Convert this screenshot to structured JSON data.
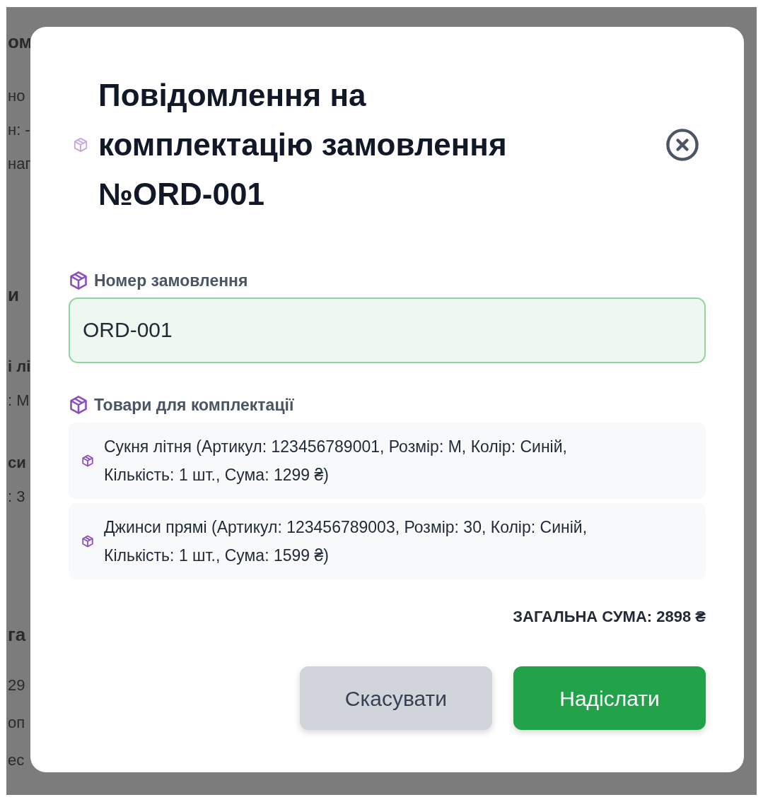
{
  "background": {
    "fragments": [
      {
        "text": "ом",
        "kind": "heading"
      },
      {
        "text": "но",
        "kind": "text"
      },
      {
        "text": "н: -",
        "kind": "text"
      },
      {
        "text": "наг",
        "kind": "text"
      },
      {
        "text": "и",
        "kind": "heading"
      },
      {
        "text": "і лі",
        "kind": "strong"
      },
      {
        "text": ": М",
        "kind": "text"
      },
      {
        "text": "си",
        "kind": "strong"
      },
      {
        "text": ": 3",
        "kind": "text"
      },
      {
        "text": "га",
        "kind": "heading"
      },
      {
        "text": "29",
        "kind": "text"
      },
      {
        "text": "оп",
        "kind": "text"
      },
      {
        "text": "ес",
        "kind": "text"
      }
    ]
  },
  "modal": {
    "title": "Повідомлення на комплектацію замовлення №ORD-001",
    "order_field": {
      "label": "Номер замовлення",
      "value": "ORD-001"
    },
    "items_label": "Товари для комплектації",
    "items": [
      {
        "text": "Сукня літня (Артикул: 123456789001, Розмір: M, Колір: Синій, Кількість: 1 шт., Сума: 1299 ₴)"
      },
      {
        "text": "Джинси прямі (Артикул: 123456789003, Розмір: 30, Колір: Синій, Кількість: 1 шт., Сума: 1599 ₴)"
      }
    ],
    "total": "ЗАГАЛЬНА СУМА: 2898 ₴",
    "buttons": [
      {
        "label": "Скасувати",
        "kind": "secondary"
      },
      {
        "label": "Надіслати",
        "kind": "primary"
      }
    ]
  }
}
